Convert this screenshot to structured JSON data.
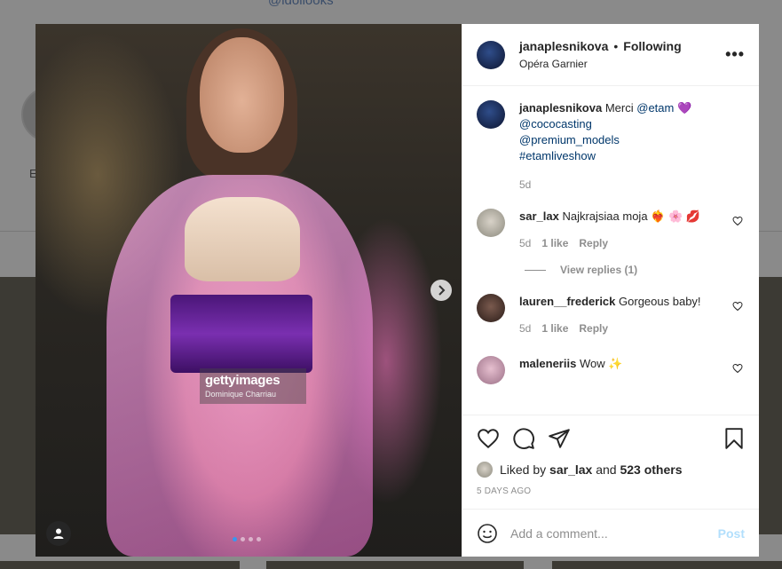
{
  "background": {
    "handle": "@idollooks",
    "story_label": "E"
  },
  "media": {
    "watermark_brand": "gettyimages",
    "watermark_credit": "Dominique Charriau",
    "slide_count": 4,
    "active_slide": 1
  },
  "header": {
    "username": "janaplesnikova",
    "separator": "•",
    "follow_status": "Following",
    "location": "Opéra Garnier",
    "more": "•••"
  },
  "caption": {
    "username": "janaplesnikova",
    "text": "Merci",
    "mention_1": "@etam",
    "emoji": "💜",
    "mention_2": "@cococasting",
    "mention_3": "@premium_models",
    "hashtag": "#etamliveshow",
    "time": "5d"
  },
  "comments": [
    {
      "username": "sar_lax",
      "text": "Najkrajsiaa moja ❤️‍🔥 🌸 💋",
      "time": "5d",
      "likes": "1 like",
      "reply": "Reply"
    },
    {
      "username": "lauren__frederick",
      "text": "Gorgeous baby!",
      "time": "5d",
      "likes": "1 like",
      "reply": "Reply"
    },
    {
      "username": "maleneriis",
      "text": "Wow ✨"
    }
  ],
  "view_replies": "View replies (1)",
  "likes": {
    "prefix": "Liked by",
    "user": "sar_lax",
    "middle": "and",
    "others": "523 others"
  },
  "timestamp": "5 DAYS AGO",
  "add_comment": {
    "placeholder": "Add a comment...",
    "post_label": "Post"
  },
  "colors": {
    "link": "#00376b",
    "meta": "#8e8e8e",
    "post_disabled": "#b2dffc",
    "active_dot": "#3897f0"
  }
}
